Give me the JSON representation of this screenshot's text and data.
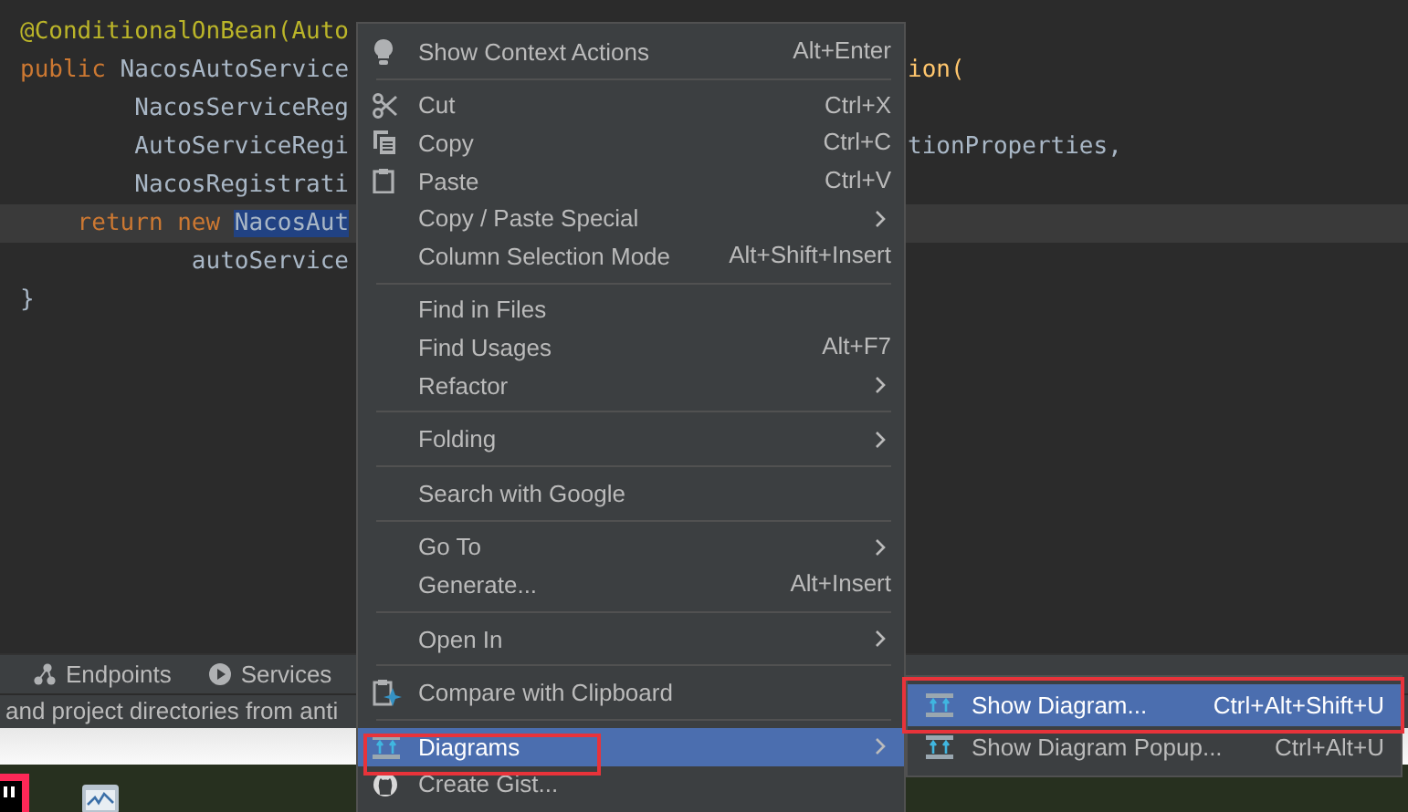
{
  "editor": {
    "lines": [
      {
        "left": [
          {
            "text": "@ConditionalOnBean(Auto",
            "kind": "annotation"
          }
        ]
      },
      {
        "left": [
          {
            "text": "public ",
            "kind": "keyword"
          },
          {
            "text": "NacosAutoService",
            "kind": "plain"
          }
        ],
        "right": [
          {
            "text": "ion(",
            "kind": "method"
          }
        ]
      },
      {
        "left": [
          {
            "text": "        NacosServiceReg",
            "kind": "plain"
          }
        ]
      },
      {
        "left": [
          {
            "text": "        AutoServiceRegi",
            "kind": "plain"
          }
        ],
        "right": [
          {
            "text": "tionProperties,",
            "kind": "plain"
          }
        ]
      },
      {
        "left": [
          {
            "text": "        NacosRegistrati",
            "kind": "plain"
          }
        ]
      },
      {
        "left": [
          {
            "text": "    return new ",
            "kind": "keyword"
          },
          {
            "text": "NacosAut",
            "kind": "selected"
          }
        ],
        "current": true
      },
      {
        "left": [
          {
            "text": "            autoService",
            "kind": "plain"
          }
        ]
      },
      {
        "left": [
          {
            "text": "}",
            "kind": "plain"
          }
        ]
      }
    ]
  },
  "tool_windows": [
    {
      "label": "Endpoints"
    },
    {
      "label": "Services"
    }
  ],
  "status_text": "and project directories from anti",
  "context_menu": {
    "items": [
      {
        "kind": "item",
        "label": "Show Context Actions",
        "shortcut": "Alt+Enter",
        "has_submenu": false,
        "selected": false
      },
      {
        "kind": "separator"
      },
      {
        "kind": "item",
        "label": "Cut",
        "shortcut": "Ctrl+X",
        "has_submenu": false,
        "selected": false
      },
      {
        "kind": "item",
        "label": "Copy",
        "shortcut": "Ctrl+C",
        "has_submenu": false,
        "selected": false
      },
      {
        "kind": "item",
        "label": "Paste",
        "shortcut": "Ctrl+V",
        "has_submenu": false,
        "selected": false
      },
      {
        "kind": "item",
        "label": "Copy / Paste Special",
        "has_submenu": true,
        "selected": false
      },
      {
        "kind": "item",
        "label": "Column Selection Mode",
        "shortcut": "Alt+Shift+Insert",
        "has_submenu": false,
        "selected": false
      },
      {
        "kind": "separator"
      },
      {
        "kind": "item",
        "label": "Find in Files",
        "has_submenu": false,
        "selected": false
      },
      {
        "kind": "item",
        "label": "Find Usages",
        "shortcut": "Alt+F7",
        "has_submenu": false,
        "selected": false
      },
      {
        "kind": "item",
        "label": "Refactor",
        "has_submenu": true,
        "selected": false
      },
      {
        "kind": "separator"
      },
      {
        "kind": "item",
        "label": "Folding",
        "has_submenu": true,
        "selected": false
      },
      {
        "kind": "separator"
      },
      {
        "kind": "item",
        "label": "Search with Google",
        "has_submenu": false,
        "selected": false
      },
      {
        "kind": "separator"
      },
      {
        "kind": "item",
        "label": "Go To",
        "has_submenu": true,
        "selected": false
      },
      {
        "kind": "item",
        "label": "Generate...",
        "shortcut": "Alt+Insert",
        "has_submenu": false,
        "selected": false
      },
      {
        "kind": "separator"
      },
      {
        "kind": "item",
        "label": "Open In",
        "has_submenu": true,
        "selected": false
      },
      {
        "kind": "separator"
      },
      {
        "kind": "item",
        "label": "Compare with Clipboard",
        "has_submenu": false,
        "selected": false
      },
      {
        "kind": "separator"
      },
      {
        "kind": "item",
        "label": "Diagrams",
        "has_submenu": true,
        "selected": true
      },
      {
        "kind": "item",
        "label": "Create Gist...",
        "has_submenu": false,
        "selected": false
      }
    ]
  },
  "submenu": {
    "items": [
      {
        "label": "Show Diagram...",
        "shortcut": "Ctrl+Alt+Shift+U",
        "selected": true
      },
      {
        "label": "Show Diagram Popup...",
        "shortcut": "Ctrl+Alt+U",
        "selected": false
      }
    ]
  }
}
